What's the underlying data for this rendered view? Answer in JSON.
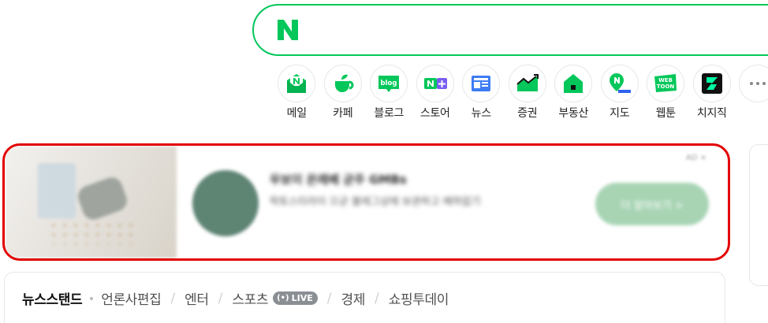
{
  "search": {
    "logo_letter": "N",
    "brand_color": "#03c75a"
  },
  "services": [
    {
      "label": "메일",
      "icon": "mail-icon"
    },
    {
      "label": "카페",
      "icon": "cafe-icon"
    },
    {
      "label": "블로그",
      "icon": "blog-icon",
      "icon_text": "blog"
    },
    {
      "label": "스토어",
      "icon": "store-icon",
      "icon_text": "N+"
    },
    {
      "label": "뉴스",
      "icon": "news-icon"
    },
    {
      "label": "증권",
      "icon": "stock-icon"
    },
    {
      "label": "부동산",
      "icon": "realestate-icon"
    },
    {
      "label": "지도",
      "icon": "map-icon"
    },
    {
      "label": "웹툰",
      "icon": "webtoon-icon",
      "icon_text": "WEB TOON"
    },
    {
      "label": "치지직",
      "icon": "chzzk-icon"
    },
    {
      "label": "",
      "icon": "more-icon"
    }
  ],
  "ad": {
    "title": "우보이 온레베 균주 GMBs",
    "description": "락토스타라이 으균 불레그상에 보관하고 배하없기",
    "cta": "더 알아보기 >",
    "tag": "AD ×"
  },
  "newsstand": {
    "items": [
      "뉴스스탠드",
      "언론사편집",
      "엔터",
      "스포츠",
      "경제",
      "쇼핑투데이"
    ],
    "live_badge": "LIVE"
  }
}
